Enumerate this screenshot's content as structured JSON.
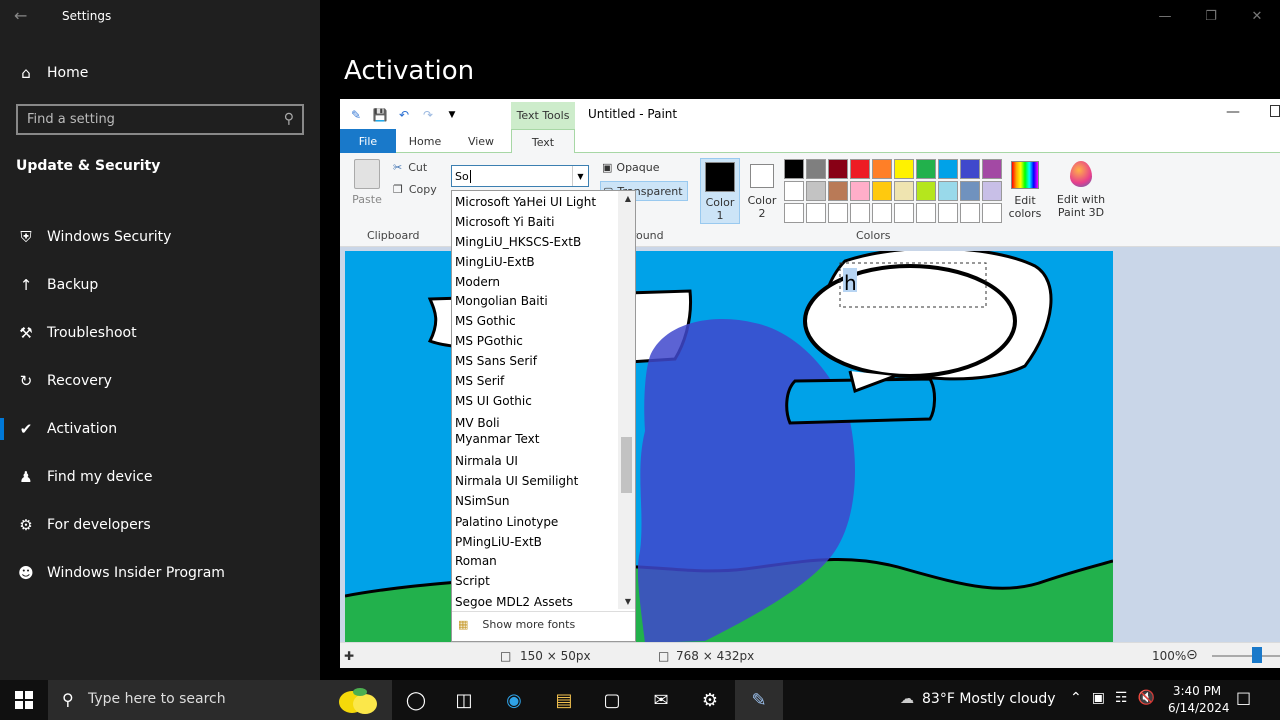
{
  "settings": {
    "title": "Settings",
    "search_placeholder": "Find a setting",
    "home_label": "Home",
    "section_header": "Update & Security",
    "page_heading": "Activation",
    "nav_items": [
      {
        "label": "Windows Security",
        "icon": "shield-icon"
      },
      {
        "label": "Backup",
        "icon": "backup-icon"
      },
      {
        "label": "Troubleshoot",
        "icon": "wrench-icon"
      },
      {
        "label": "Recovery",
        "icon": "recovery-icon"
      },
      {
        "label": "Activation",
        "icon": "check-circle-icon"
      },
      {
        "label": "Find my device",
        "icon": "person-pin-icon"
      },
      {
        "label": "For developers",
        "icon": "developer-icon"
      },
      {
        "label": "Windows Insider Program",
        "icon": "insider-icon"
      }
    ],
    "active_item": "Activation"
  },
  "paint": {
    "title": "Untitled - Paint",
    "context_tab": "Text Tools",
    "tabs": [
      "File",
      "Home",
      "View",
      "Text"
    ],
    "clipboard": {
      "paste": "Paste",
      "cut": "Cut",
      "copy": "Copy",
      "group": "Clipboard"
    },
    "font_value": "So",
    "background": {
      "opaque": "Opaque",
      "transparent": "Transparent",
      "group": "Background"
    },
    "colors": {
      "color1": "Color 1",
      "color2": "Color 2",
      "edit_colors": "Edit colors",
      "edit_3d": "Edit with Paint 3D",
      "group": "Colors",
      "palette": [
        "#000000",
        "#7f7f7f",
        "#880015",
        "#ed1c24",
        "#ff7f27",
        "#fff200",
        "#22b14c",
        "#00a2e8",
        "#3f48cc",
        "#a349a4",
        "#ffffff",
        "#c3c3c3",
        "#b97a57",
        "#ffaec9",
        "#ffc90e",
        "#efe4b0",
        "#b5e61d",
        "#99d9ea",
        "#7092be",
        "#c8bfe7",
        "#ffffff",
        "#ffffff",
        "#ffffff",
        "#ffffff",
        "#ffffff",
        "#ffffff",
        "#ffffff",
        "#ffffff",
        "#ffffff",
        "#ffffff"
      ]
    },
    "status": {
      "selection_size": "150 × 50px",
      "image_size": "768 × 432px",
      "zoom": "100%"
    },
    "text_box_content": "h",
    "font_list": [
      "Microsoft YaHei UI Light",
      "Microsoft Yi Baiti",
      "MingLiU_HKSCS-ExtB",
      "MingLiU-ExtB",
      "Modern",
      "Mongolian Baiti",
      "MS Gothic",
      "MS PGothic",
      "MS Sans Serif",
      "MS Serif",
      "MS UI Gothic",
      "MV Boli",
      "Myanmar Text",
      "Nirmala UI",
      "Nirmala UI Semilight",
      "NSimSun",
      "Palatino Linotype",
      "PMingLiU-ExtB",
      "Roman",
      "Script",
      "Segoe MDL2 Assets"
    ],
    "show_more_fonts": "Show more fonts"
  },
  "taskbar": {
    "search_placeholder": "Type here to search",
    "weather": "83°F  Mostly cloudy",
    "time": "3:40 PM",
    "date": "6/14/2024"
  }
}
